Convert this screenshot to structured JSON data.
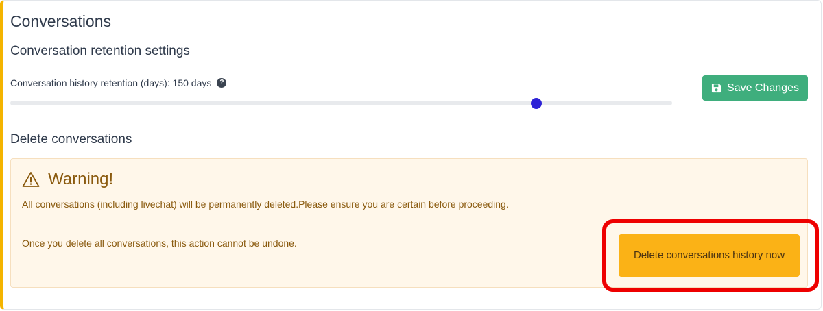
{
  "page": {
    "title": "Conversations"
  },
  "retention": {
    "section_title": "Conversation retention settings",
    "label": "Conversation history retention (days): 150 days",
    "help_icon": "?",
    "slider_value_fraction": 0.795,
    "save_label": "Save Changes",
    "save_icon": "floppy-disk-icon"
  },
  "delete": {
    "section_title": "Delete conversations",
    "warning_icon": "warning-triangle-icon",
    "warning_title": "Warning!",
    "warning_text": "All conversations (including livechat) will be permanently deleted.Please ensure you are certain before proceeding.",
    "undo_text": "Once you delete all conversations, this action cannot be undone.",
    "button_label": "Delete conversations history now"
  },
  "colors": {
    "accent_bar": "#f4b400",
    "save_button": "#3fae7d",
    "slider_thumb": "#2d22d6",
    "warning_bg": "#fff7ea",
    "warning_text": "#8a5a0e",
    "delete_button": "#fbb216",
    "highlight": "#ee0000"
  }
}
